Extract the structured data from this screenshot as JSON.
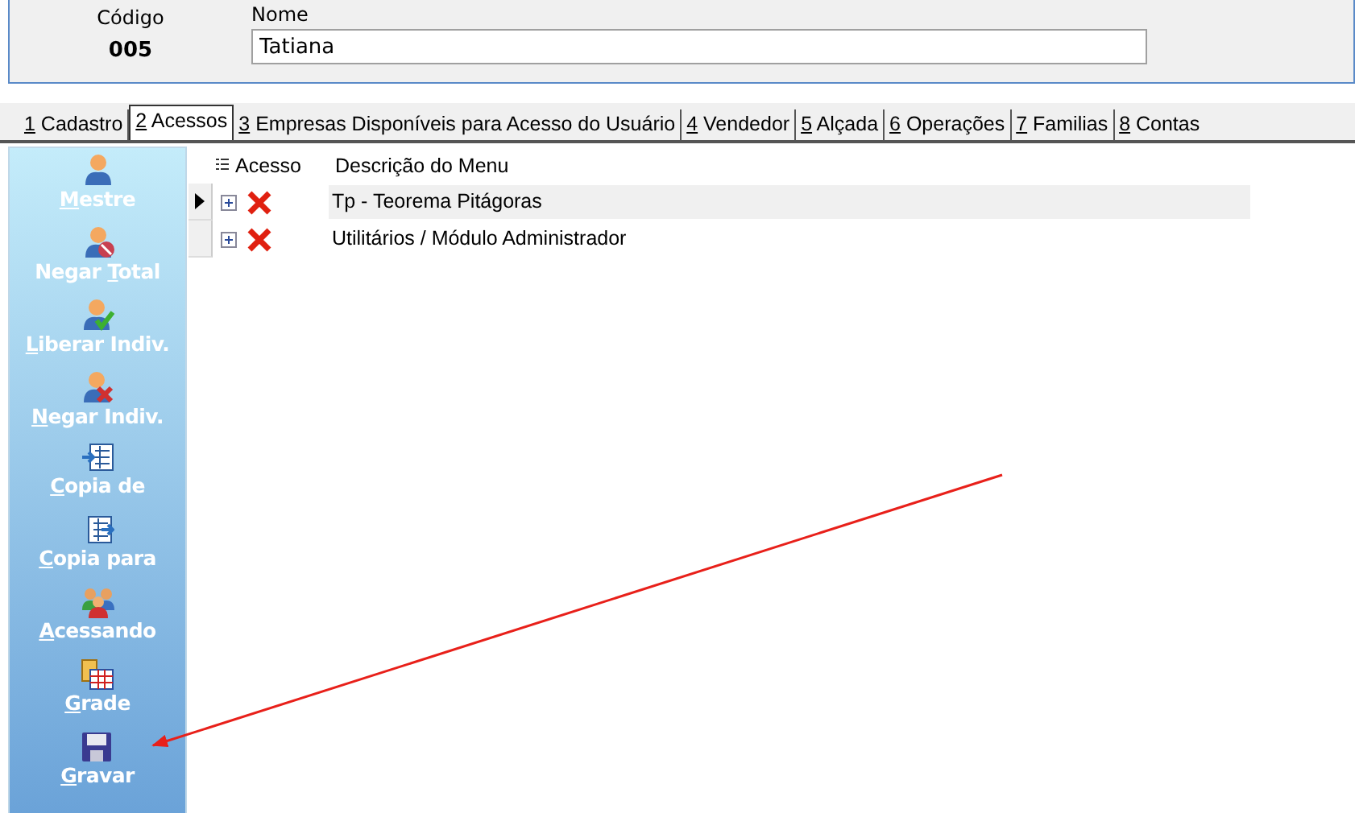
{
  "header": {
    "code_label": "Código",
    "code_value": "005",
    "name_label": "Nome",
    "name_value": "Tatiana"
  },
  "tabs": [
    {
      "key": "1",
      "label": "Cadastro",
      "selected": false
    },
    {
      "key": "2",
      "label": "Acessos",
      "selected": true
    },
    {
      "key": "3",
      "label": "Empresas Disponíveis para Acesso do Usuário",
      "selected": false
    },
    {
      "key": "4",
      "label": "Vendedor",
      "selected": false
    },
    {
      "key": "5",
      "label": "Alçada",
      "selected": false
    },
    {
      "key": "6",
      "label": "Operações",
      "selected": false
    },
    {
      "key": "7",
      "label": "Familias",
      "selected": false
    },
    {
      "key": "8",
      "label": "Contas",
      "selected": false
    }
  ],
  "sidebar": [
    {
      "kind": "user",
      "key": "M",
      "post": "estre"
    },
    {
      "kind": "user-block",
      "pre": "Negar ",
      "key": "T",
      "post": "otal"
    },
    {
      "kind": "user-check",
      "key": "L",
      "post": "iberar Indiv."
    },
    {
      "kind": "user-x",
      "key": "N",
      "post": "egar Indiv."
    },
    {
      "kind": "copy-in",
      "key": "C",
      "post": "opia de"
    },
    {
      "kind": "copy-out",
      "key": "C",
      "post": "opia para"
    },
    {
      "kind": "users",
      "key": "A",
      "post": "cessando"
    },
    {
      "kind": "grid",
      "key": "G",
      "post": "rade"
    },
    {
      "kind": "save",
      "key": "G",
      "post": "ravar"
    }
  ],
  "table": {
    "columns": [
      "Acesso",
      "Descrição do Menu"
    ],
    "rows": [
      {
        "description": "Tp - Teorema Pitágoras",
        "selected": true,
        "access": false
      },
      {
        "description": "Utilitários / Módulo Administrador",
        "selected": false,
        "access": false
      }
    ]
  }
}
